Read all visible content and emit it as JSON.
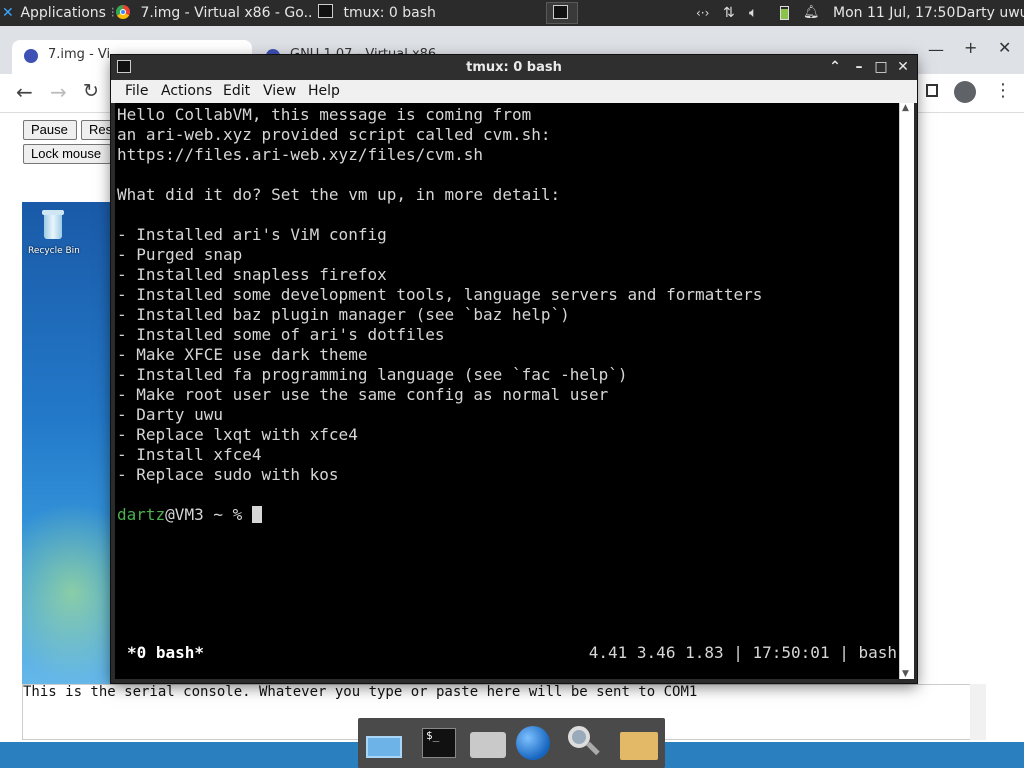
{
  "panel": {
    "applications_label": "Applications",
    "task_browser_title": "7.img - Virtual x86 - Go...",
    "task_terminal_title": "tmux: 0 bash",
    "datetime": "Mon 11 Jul, 17:50",
    "user": "Darty uwu"
  },
  "chrome": {
    "tab1_title": "7.img - Vi",
    "tab2_title": "GNU 1.07 - Virtual x86",
    "pause_label": "Pause",
    "reset_label": "Res",
    "lock_mouse_label": "Lock mouse",
    "recycle_bin_label": "Recycle Bin"
  },
  "serial": {
    "text": "This is the serial console. Whatever you type or paste here will be sent to COM1"
  },
  "terminal": {
    "title": "tmux: 0 bash",
    "menu": [
      "File",
      "Actions",
      "Edit",
      "View",
      "Help"
    ],
    "lines": [
      "Hello CollabVM, this message is coming from",
      "an ari-web.xyz provided script called cvm.sh:",
      "https://files.ari-web.xyz/files/cvm.sh",
      "",
      "What did it do? Set the vm up, in more detail:",
      "",
      "- Installed ari's ViM config",
      "- Purged snap",
      "- Installed snapless firefox",
      "- Installed some development tools, language servers and formatters",
      "- Installed baz plugin manager (see `baz help`)",
      "- Installed some of ari's dotfiles",
      "- Make XFCE use dark theme",
      "- Installed fa programming language (see `fac -help`)",
      "- Make root user use the same config as normal user",
      "- Darty uwu",
      "- Replace lxqt with xfce4",
      "- Install xfce4",
      "- Replace sudo with kos"
    ],
    "prompt_user": "dartz",
    "prompt_rest": "@VM3 ~ % ",
    "status_left": "*0 bash*",
    "status_right": "4.41 3.46 1.83 | 17:50:01 | bash"
  },
  "colors": {
    "prompt_green": "#4caf50",
    "terminal_bg": "#000000",
    "panel_bg": "#2b2b2b",
    "dock_bg": "#4a4a4a"
  }
}
